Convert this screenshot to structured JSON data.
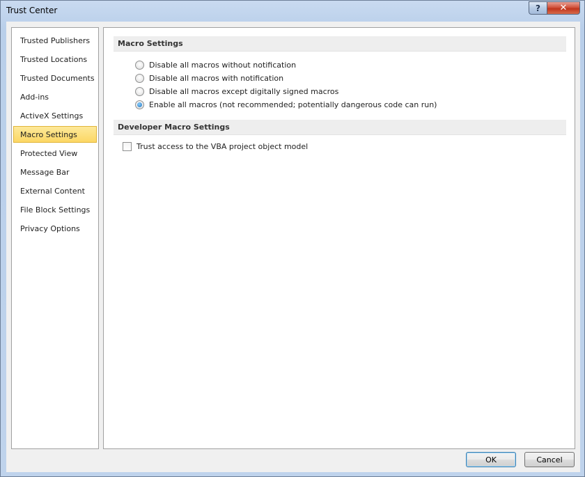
{
  "window": {
    "title": "Trust Center",
    "help_glyph": "?",
    "close_glyph": "✕"
  },
  "sidebar": {
    "items": [
      {
        "label": "Trusted Publishers",
        "selected": false
      },
      {
        "label": "Trusted Locations",
        "selected": false
      },
      {
        "label": "Trusted Documents",
        "selected": false
      },
      {
        "label": "Add-ins",
        "selected": false
      },
      {
        "label": "ActiveX Settings",
        "selected": false
      },
      {
        "label": "Macro Settings",
        "selected": true
      },
      {
        "label": "Protected View",
        "selected": false
      },
      {
        "label": "Message Bar",
        "selected": false
      },
      {
        "label": "External Content",
        "selected": false
      },
      {
        "label": "File Block Settings",
        "selected": false
      },
      {
        "label": "Privacy Options",
        "selected": false
      }
    ]
  },
  "macro_settings": {
    "header": "Macro Settings",
    "options": [
      {
        "label": "Disable all macros without notification",
        "checked": false
      },
      {
        "label": "Disable all macros with notification",
        "checked": false
      },
      {
        "label": "Disable all macros except digitally signed macros",
        "checked": false
      },
      {
        "label": "Enable all macros (not recommended; potentially dangerous code can run)",
        "checked": true
      }
    ]
  },
  "developer_settings": {
    "header": "Developer Macro Settings",
    "vba_access_label": "Trust access to the VBA project object model",
    "vba_access_checked": false
  },
  "buttons": {
    "ok": "OK",
    "cancel": "Cancel"
  },
  "colors": {
    "selected_item": "#fcd764",
    "selected_border": "#e0b53a",
    "close_button": "#c0351c",
    "section_header_bg": "#eeeeee"
  }
}
